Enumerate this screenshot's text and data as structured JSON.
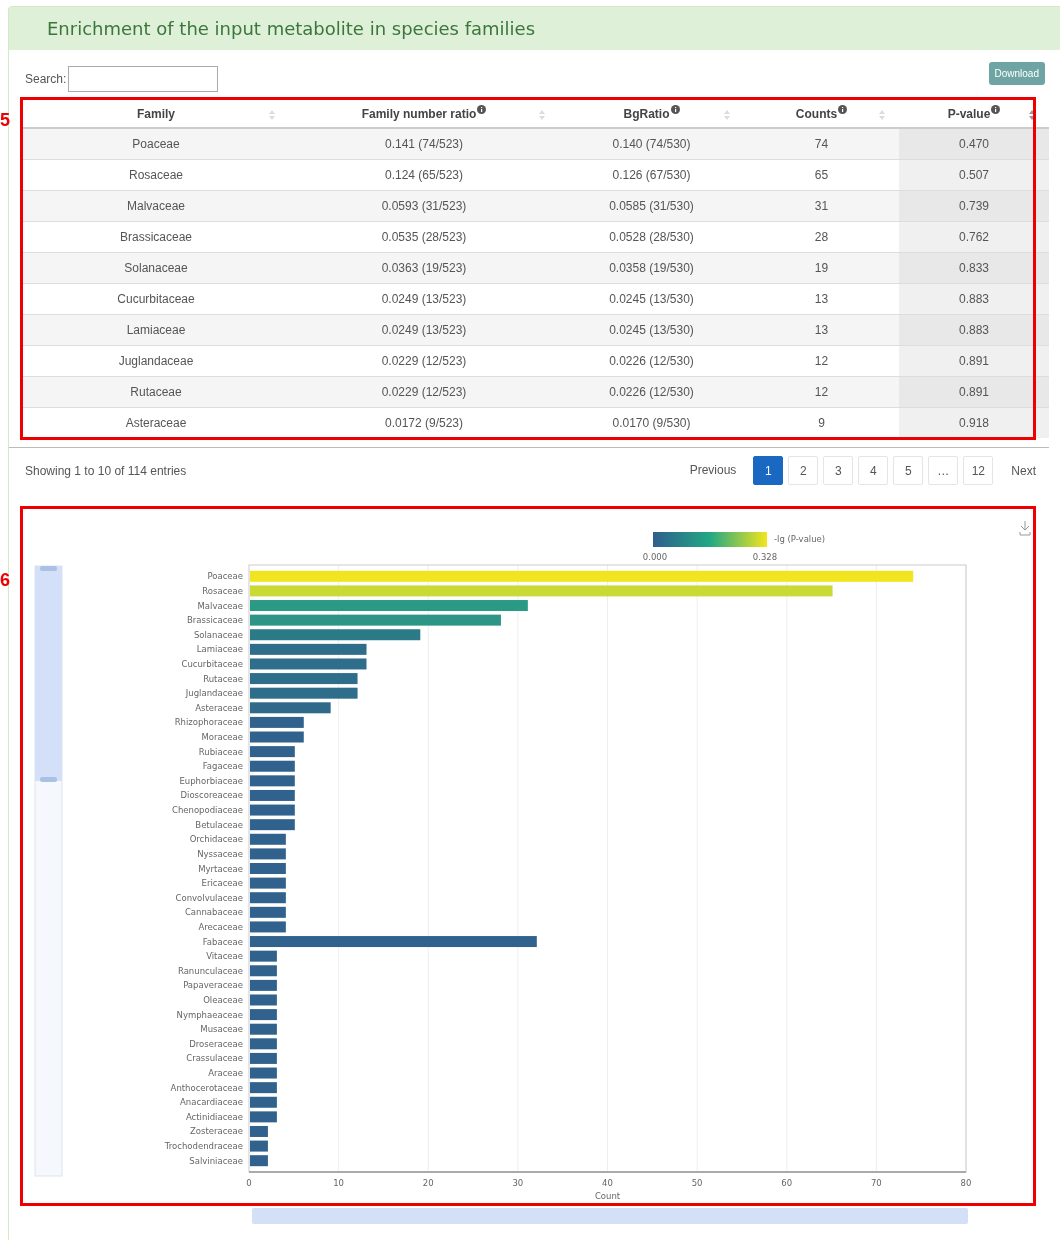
{
  "annotations": [
    {
      "label": "5"
    },
    {
      "label": "6"
    }
  ],
  "panel": {
    "title": "Enrichment of the input metabolite in species families"
  },
  "search": {
    "label": "Search:"
  },
  "download_button": "Download",
  "table": {
    "columns": [
      {
        "label": "Family",
        "info": false,
        "sorted": false
      },
      {
        "label": "Family number ratio",
        "info": true,
        "sorted": false
      },
      {
        "label": "BgRatio",
        "info": true,
        "sorted": false
      },
      {
        "label": "Counts",
        "info": true,
        "sorted": false
      },
      {
        "label": "P-value",
        "info": true,
        "sorted": true
      }
    ],
    "rows": [
      [
        "Poaceae",
        "0.141 (74/523)",
        "0.140 (74/530)",
        "74",
        "0.470"
      ],
      [
        "Rosaceae",
        "0.124 (65/523)",
        "0.126 (67/530)",
        "65",
        "0.507"
      ],
      [
        "Malvaceae",
        "0.0593 (31/523)",
        "0.0585 (31/530)",
        "31",
        "0.739"
      ],
      [
        "Brassicaceae",
        "0.0535 (28/523)",
        "0.0528 (28/530)",
        "28",
        "0.762"
      ],
      [
        "Solanaceae",
        "0.0363 (19/523)",
        "0.0358 (19/530)",
        "19",
        "0.833"
      ],
      [
        "Cucurbitaceae",
        "0.0249 (13/523)",
        "0.0245 (13/530)",
        "13",
        "0.883"
      ],
      [
        "Lamiaceae",
        "0.0249 (13/523)",
        "0.0245 (13/530)",
        "13",
        "0.883"
      ],
      [
        "Juglandaceae",
        "0.0229 (12/523)",
        "0.0226 (12/530)",
        "12",
        "0.891"
      ],
      [
        "Rutaceae",
        "0.0229 (12/523)",
        "0.0226 (12/530)",
        "12",
        "0.891"
      ],
      [
        "Asteraceae",
        "0.0172 (9/523)",
        "0.0170 (9/530)",
        "9",
        "0.918"
      ]
    ]
  },
  "info": "Showing 1 to 10 of 114 entries",
  "pagination": [
    {
      "label": "Previous",
      "selected": false
    },
    {
      "label": "1",
      "selected": true
    },
    {
      "label": "2",
      "selected": false
    },
    {
      "label": "3",
      "selected": false
    },
    {
      "label": "4",
      "selected": false
    },
    {
      "label": "5",
      "selected": false
    },
    {
      "label": "…",
      "selected": false
    },
    {
      "label": "12",
      "selected": false
    },
    {
      "label": "Next",
      "selected": false
    }
  ],
  "chart": {
    "legend": {
      "title": "-lg (P-value)",
      "min": "0.000",
      "max": "0.328"
    },
    "chart_data": {
      "type": "bar",
      "orientation": "horizontal",
      "xlabel": "Count",
      "xlim": [
        0,
        80
      ],
      "xticks": [
        0,
        10,
        20,
        30,
        40,
        50,
        60,
        70,
        80
      ],
      "categories": [
        "Poaceae",
        "Rosaceae",
        "Malvaceae",
        "Brassicaceae",
        "Solanaceae",
        "Lamiaceae",
        "Cucurbitaceae",
        "Rutaceae",
        "Juglandaceae",
        "Asteraceae",
        "Rhizophoraceae",
        "Moraceae",
        "Rubiaceae",
        "Fagaceae",
        "Euphorbiaceae",
        "Dioscoreaceae",
        "Chenopodiaceae",
        "Betulaceae",
        "Orchidaceae",
        "Nyssaceae",
        "Myrtaceae",
        "Ericaceae",
        "Convolvulaceae",
        "Cannabaceae",
        "Arecaceae",
        "Fabaceae",
        "Vitaceae",
        "Ranunculaceae",
        "Papaveraceae",
        "Oleaceae",
        "Nymphaeaceae",
        "Musaceae",
        "Droseraceae",
        "Crassulaceae",
        "Araceae",
        "Anthocerotaceae",
        "Anacardiaceae",
        "Actinidiaceae",
        "Zosteraceae",
        "Trochodendraceae",
        "Salviniaceae"
      ],
      "grid": true,
      "series": [
        {
          "values": [
            74,
            65,
            31,
            28,
            19,
            13,
            13,
            12,
            12,
            9,
            6,
            6,
            5,
            5,
            5,
            5,
            5,
            5,
            4,
            4,
            4,
            4,
            4,
            4,
            4,
            32,
            3,
            3,
            3,
            3,
            3,
            3,
            3,
            3,
            3,
            3,
            3,
            3,
            2,
            2,
            2
          ],
          "colors": [
            "#f0e51e",
            "#c9da35",
            "#2a9a84",
            "#2e9486",
            "#2a7a88",
            "#2e6e8a",
            "#2e6e8a",
            "#2e6e8a",
            "#2e6e8a",
            "#2f6a8b",
            "#31628e",
            "#31628e",
            "#31628e",
            "#31628e",
            "#31628e",
            "#31628e",
            "#31628e",
            "#31628e",
            "#31628e",
            "#31628e",
            "#31628e",
            "#31628e",
            "#31628e",
            "#31628e",
            "#31628e",
            "#31628e",
            "#31628e",
            "#31628e",
            "#31628e",
            "#31628e",
            "#31628e",
            "#31628e",
            "#31628e",
            "#31628e",
            "#31628e",
            "#31628e",
            "#31628e",
            "#31628e",
            "#31628e",
            "#31628e",
            "#31628e"
          ]
        }
      ]
    }
  }
}
